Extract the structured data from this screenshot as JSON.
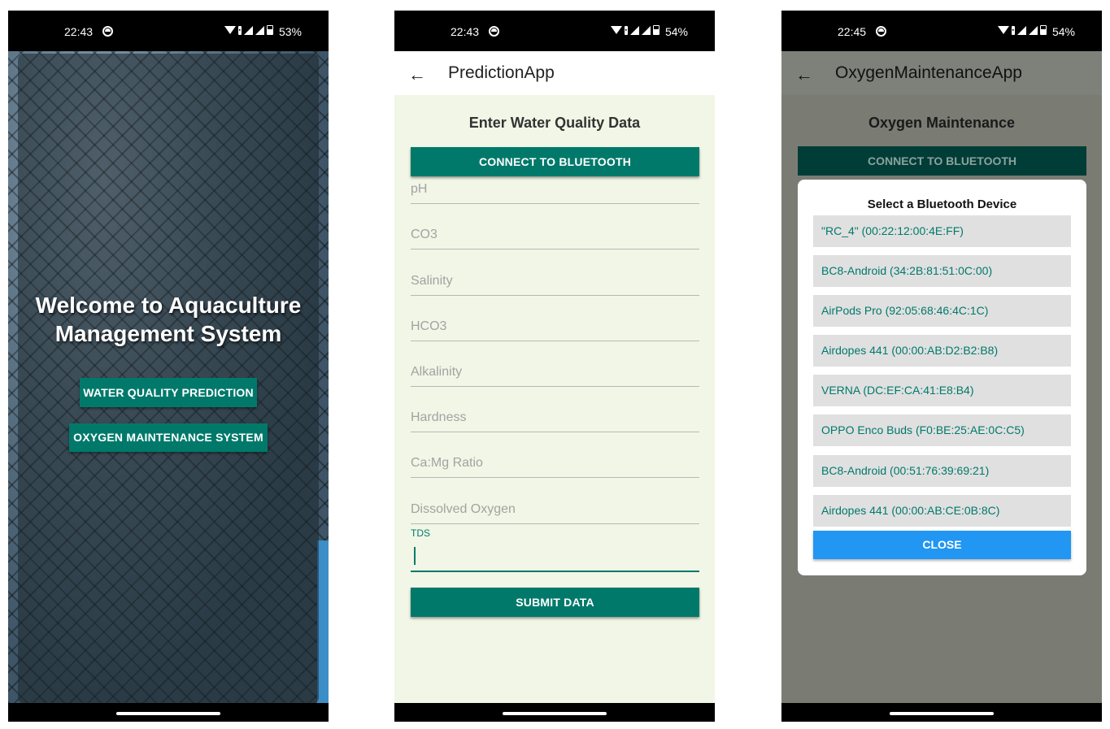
{
  "phone1": {
    "status": {
      "time": "22:43",
      "battery": "53%"
    },
    "welcome_line1": "Welcome to Aquaculture",
    "welcome_line2": "Management System",
    "btn_water": "WATER QUALITY PREDICTION",
    "btn_oxygen": "OXYGEN MAINTENANCE SYSTEM"
  },
  "phone2": {
    "status": {
      "time": "22:43",
      "battery": "54%"
    },
    "app_title": "PredictionApp",
    "heading": "Enter Water Quality Data",
    "connect_btn": "CONNECT TO BLUETOOTH",
    "fields": [
      "pH",
      "CO3",
      "Salinity",
      "HCO3",
      "Alkalinity",
      "Hardness",
      "Ca:Mg Ratio",
      "Dissolved Oxygen"
    ],
    "tds_label": "TDS",
    "submit_btn": "SUBMIT DATA"
  },
  "phone3": {
    "status": {
      "time": "22:45",
      "battery": "54%"
    },
    "app_title": "OxygenMaintenanceApp",
    "heading": "Oxygen Maintenance",
    "connect_btn": "CONNECT TO BLUETOOTH",
    "dialog_title": "Select a Bluetooth Device",
    "devices": [
      "\"RC_4\" (00:22:12:00:4E:FF)",
      "BC8-Android (34:2B:81:51:0C:00)",
      "AirPods Pro (92:05:68:46:4C:1C)",
      "Airdopes 441 (00:00:AB:D2:B2:B8)",
      "VERNA (DC:EF:CA:41:E8:B4)",
      "OPPO Enco Buds (F0:BE:25:AE:0C:C5)",
      "BC8-Android (00:51:76:39:69:21)",
      "Airdopes 441 (00:00:AB:CE:0B:8C)"
    ],
    "close_btn": "CLOSE"
  },
  "colors": {
    "accent": "#00796b",
    "close_blue": "#2196f3",
    "form_bg": "#f1f6e6"
  }
}
